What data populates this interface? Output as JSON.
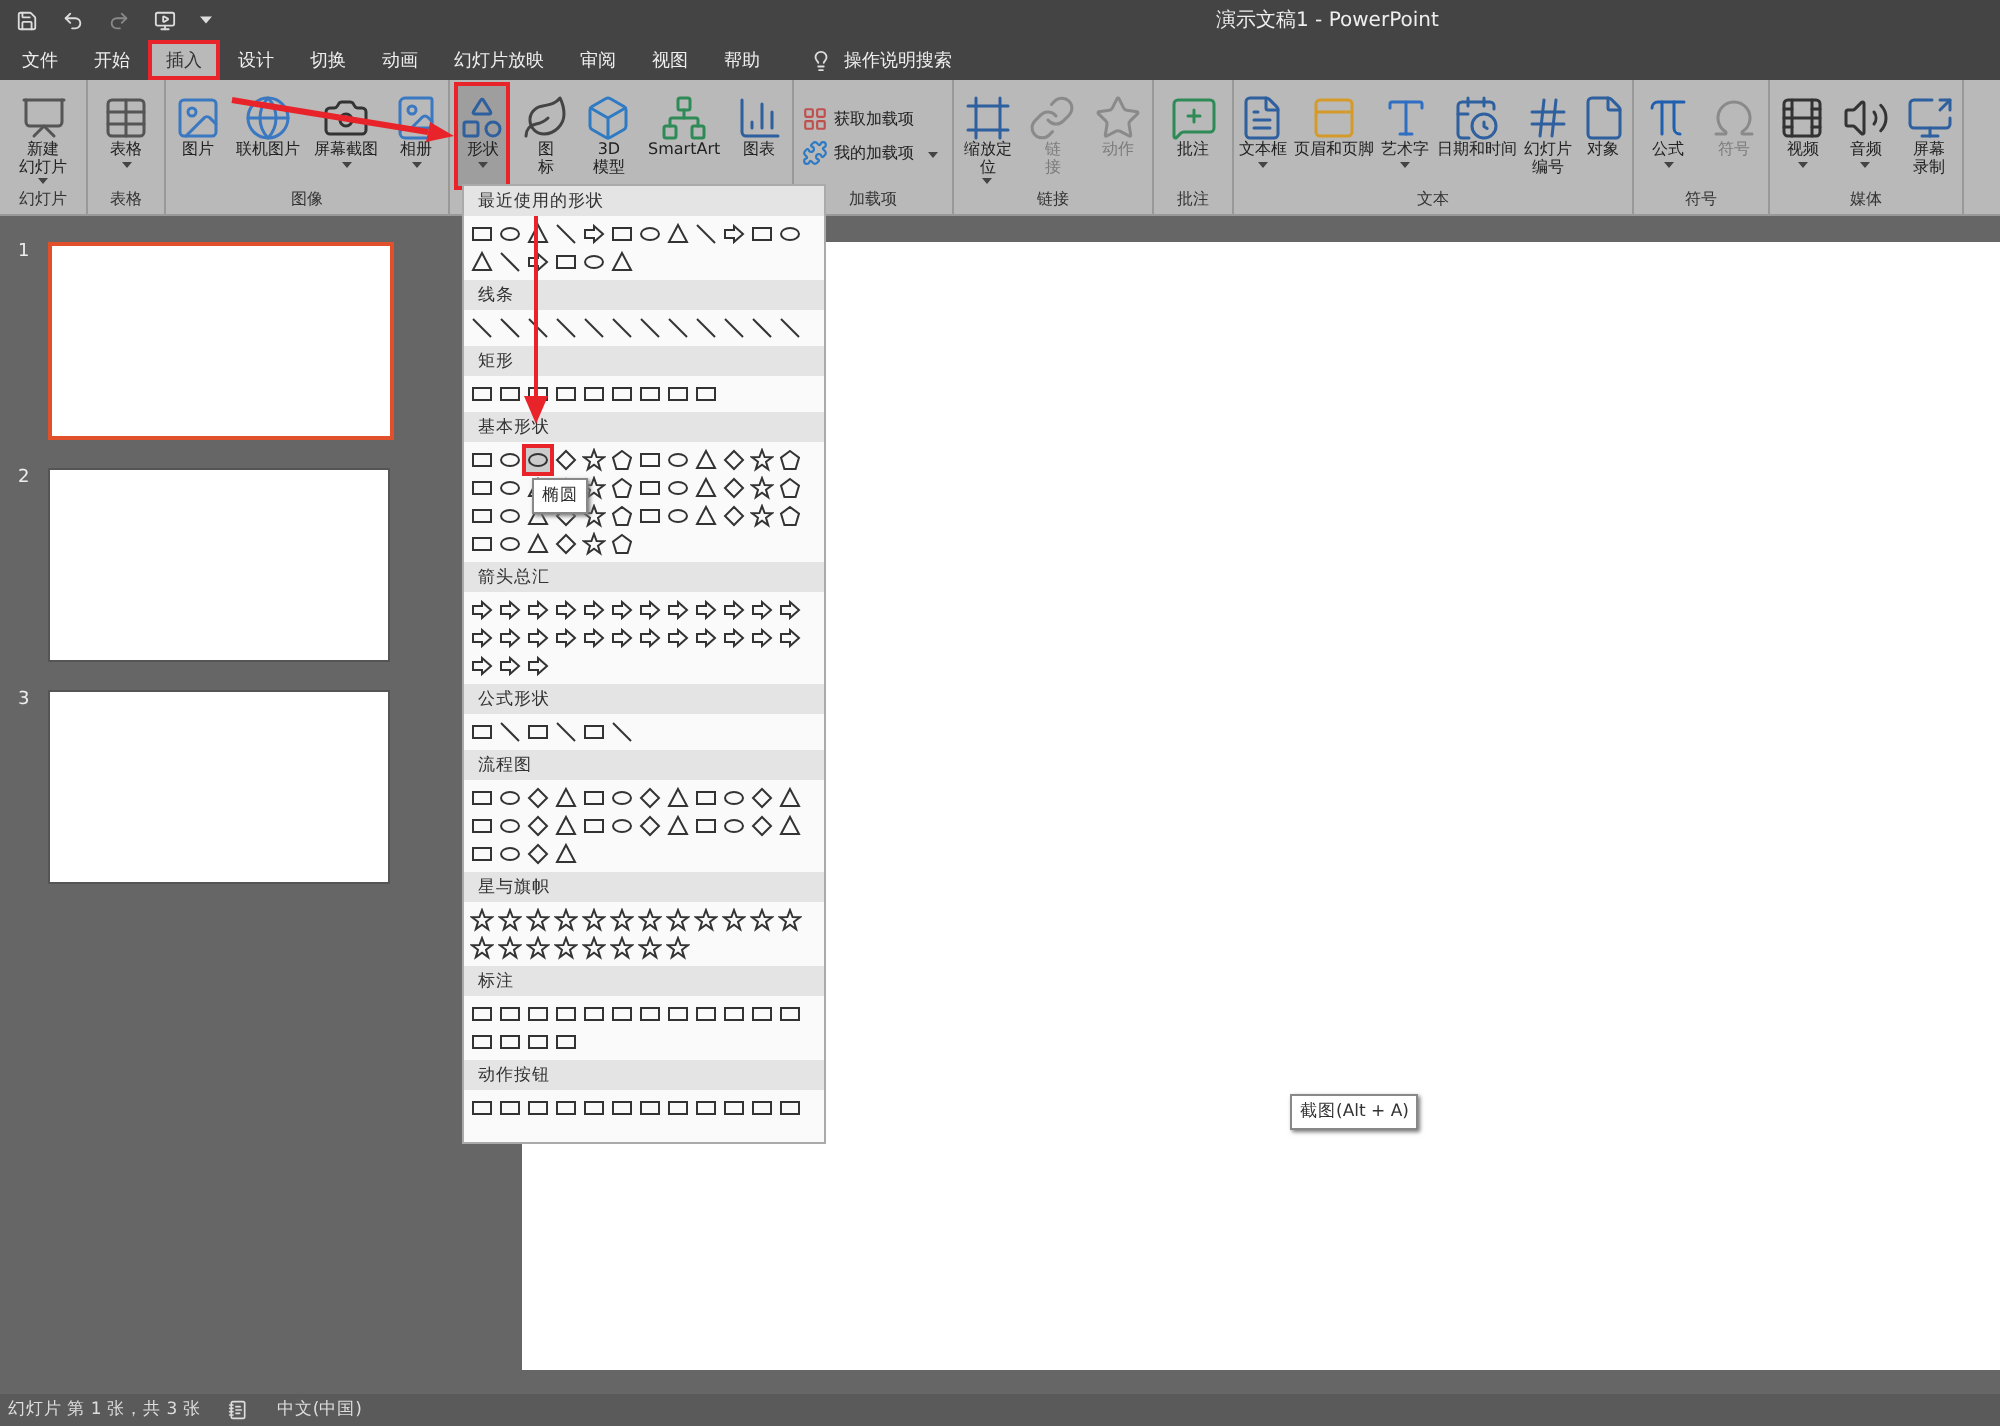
{
  "window": {
    "title": "演示文稿1  -  PowerPoint"
  },
  "tabs": [
    {
      "label": "文件",
      "selected": false,
      "highlighted": false
    },
    {
      "label": "开始",
      "selected": false,
      "highlighted": false
    },
    {
      "label": "插入",
      "selected": true,
      "highlighted": true
    },
    {
      "label": "设计",
      "selected": false,
      "highlighted": false
    },
    {
      "label": "切换",
      "selected": false,
      "highlighted": false
    },
    {
      "label": "动画",
      "selected": false,
      "highlighted": false
    },
    {
      "label": "幻灯片放映",
      "selected": false,
      "highlighted": false
    },
    {
      "label": "审阅",
      "selected": false,
      "highlighted": false
    },
    {
      "label": "视图",
      "selected": false,
      "highlighted": false
    },
    {
      "label": "帮助",
      "selected": false,
      "highlighted": false
    }
  ],
  "search": {
    "placeholder": "操作说明搜索"
  },
  "ribbon": [
    {
      "label": "幻灯片",
      "kind": "large",
      "buttons": [
        {
          "lines": [
            "新建",
            "幻灯片"
          ],
          "dropdown": true
        }
      ]
    },
    {
      "label": "表格",
      "kind": "large",
      "buttons": [
        {
          "lines": [
            "表格"
          ],
          "dropdown": true
        }
      ]
    },
    {
      "label": "图像",
      "kind": "large",
      "buttons": [
        {
          "lines": [
            "图片"
          ]
        },
        {
          "lines": [
            "联机图片"
          ]
        },
        {
          "lines": [
            "屏幕截图"
          ],
          "dropdown": true
        },
        {
          "lines": [
            "相册"
          ],
          "dropdown": true
        }
      ]
    },
    {
      "kind": "large",
      "buttons": [
        {
          "lines": [
            "形状"
          ],
          "dropdown": true,
          "highlighted": true
        },
        {
          "lines": [
            "图",
            "标"
          ]
        },
        {
          "lines": [
            "3D",
            "模型"
          ]
        },
        {
          "lines": [
            "SmartArt"
          ]
        },
        {
          "lines": [
            "图表"
          ]
        }
      ]
    },
    {
      "label": "加载项",
      "kind": "small",
      "buttons": [
        {
          "lines": [
            "获取加载项"
          ]
        },
        {
          "lines": [
            "我的加载项"
          ],
          "dropdown": true
        }
      ]
    },
    {
      "label": "链接",
      "kind": "large",
      "buttons": [
        {
          "lines": [
            "缩放定",
            "位"
          ],
          "dropdown": true
        },
        {
          "lines": [
            "链",
            "接"
          ],
          "disabled": true
        },
        {
          "lines": [
            "动作"
          ],
          "disabled": true
        }
      ]
    },
    {
      "label": "批注",
      "kind": "large",
      "buttons": [
        {
          "lines": [
            "批注"
          ]
        }
      ]
    },
    {
      "label": "文本",
      "kind": "large",
      "buttons": [
        {
          "lines": [
            "文本框"
          ],
          "dropdown": true
        },
        {
          "lines": [
            "页眉和页脚"
          ]
        },
        {
          "lines": [
            "艺术字"
          ],
          "dropdown": true
        },
        {
          "lines": [
            "日期和时间"
          ]
        },
        {
          "lines": [
            "幻灯片",
            "编号"
          ]
        },
        {
          "lines": [
            "对象"
          ]
        }
      ]
    },
    {
      "label": "符号",
      "kind": "large",
      "buttons": [
        {
          "lines": [
            "公式"
          ],
          "dropdown": true
        },
        {
          "lines": [
            "符号"
          ],
          "disabled": true
        }
      ]
    },
    {
      "label": "媒体",
      "kind": "large",
      "buttons": [
        {
          "lines": [
            "视频"
          ],
          "dropdown": true
        },
        {
          "lines": [
            "音频"
          ],
          "dropdown": true
        },
        {
          "lines": [
            "屏幕",
            "录制"
          ]
        }
      ]
    }
  ],
  "shapes_gallery": {
    "sections": [
      {
        "title": "最近使用的形状"
      },
      {
        "title": "线条"
      },
      {
        "title": "矩形"
      },
      {
        "title": "基本形状",
        "hovered_tooltip": "椭圆"
      },
      {
        "title": "箭头总汇"
      },
      {
        "title": "公式形状"
      },
      {
        "title": "流程图"
      },
      {
        "title": "星与旗帜"
      },
      {
        "title": "标注"
      },
      {
        "title": "动作按钮"
      }
    ]
  },
  "slides": [
    {
      "number": "1",
      "selected": true
    },
    {
      "number": "2",
      "selected": false
    },
    {
      "number": "3",
      "selected": false
    }
  ],
  "screen_tooltip": "截图(Alt + A)",
  "status_bar": {
    "slide_info": "幻灯片 第 1 张，共 3 张",
    "language": "中文(中国)"
  }
}
